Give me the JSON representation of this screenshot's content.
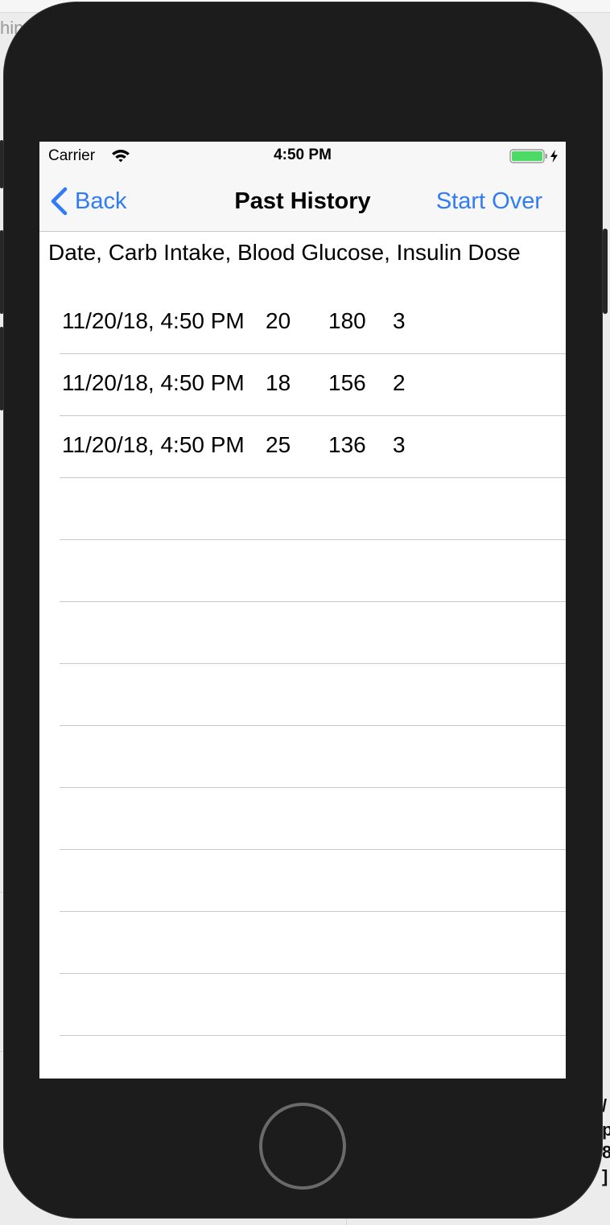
{
  "desktop": {
    "left_text": "hin",
    "right_text": [
      "/",
      "p",
      "8",
      "]"
    ]
  },
  "status_bar": {
    "carrier": "Carrier",
    "time": "4:50 PM",
    "wifi_icon": "wifi-icon",
    "battery_icon": "battery-charging-icon",
    "battery_level": 1.0,
    "battery_color": "#4cd964"
  },
  "nav": {
    "back_label": "Back",
    "back_icon": "chevron-left-icon",
    "title": "Past History",
    "start_over_label": "Start Over",
    "accent_color": "#2f7cf6"
  },
  "header_label": "Date, Carb Intake, Blood Glucose, Insulin Dose",
  "entries": [
    {
      "date": "11/20/18, 4:50 PM",
      "carb": "20",
      "glucose": "180",
      "dose": "3"
    },
    {
      "date": "11/20/18, 4:50 PM",
      "carb": "18",
      "glucose": "156",
      "dose": "2"
    },
    {
      "date": "11/20/18, 4:50 PM",
      "carb": "25",
      "glucose": "136",
      "dose": "3"
    },
    {
      "date": "",
      "carb": "",
      "glucose": "",
      "dose": ""
    },
    {
      "date": "",
      "carb": "",
      "glucose": "",
      "dose": ""
    },
    {
      "date": "",
      "carb": "",
      "glucose": "",
      "dose": ""
    },
    {
      "date": "",
      "carb": "",
      "glucose": "",
      "dose": ""
    },
    {
      "date": "",
      "carb": "",
      "glucose": "",
      "dose": ""
    },
    {
      "date": "",
      "carb": "",
      "glucose": "",
      "dose": ""
    },
    {
      "date": "",
      "carb": "",
      "glucose": "",
      "dose": ""
    },
    {
      "date": "",
      "carb": "",
      "glucose": "",
      "dose": ""
    },
    {
      "date": "",
      "carb": "",
      "glucose": "",
      "dose": ""
    }
  ],
  "home_button_icon": "home-button-icon"
}
